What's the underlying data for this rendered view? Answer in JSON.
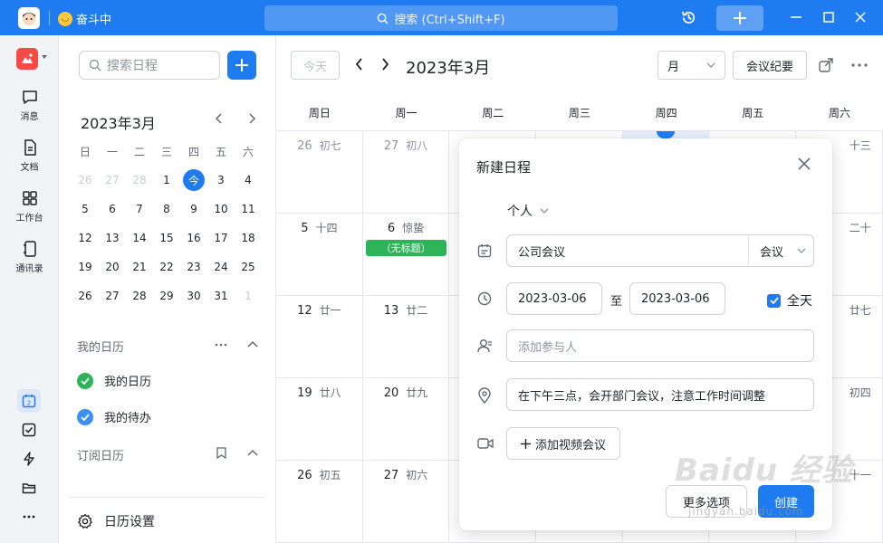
{
  "titlebar": {
    "status_text": "奋斗中",
    "search_placeholder": "搜索 (Ctrl+Shift+F)",
    "accent": "#1f7cf0"
  },
  "nav": {
    "items": [
      {
        "label": "消息",
        "icon": "chat-icon"
      },
      {
        "label": "文档",
        "icon": "doc-icon"
      },
      {
        "label": "工作台",
        "icon": "grid-icon"
      },
      {
        "label": "通讯录",
        "icon": "contacts-icon"
      }
    ],
    "bottom_calendar_badge": "2"
  },
  "side": {
    "search_placeholder": "搜索日程",
    "mini_title": "2023年3月",
    "weekday_heads": [
      "日",
      "一",
      "二",
      "三",
      "四",
      "五",
      "六"
    ],
    "days": [
      {
        "d": "26",
        "muted": true
      },
      {
        "d": "27",
        "muted": true
      },
      {
        "d": "28",
        "muted": true
      },
      {
        "d": "1"
      },
      {
        "d": "今",
        "today": true
      },
      {
        "d": "3"
      },
      {
        "d": "4"
      },
      {
        "d": "5"
      },
      {
        "d": "6"
      },
      {
        "d": "7"
      },
      {
        "d": "8"
      },
      {
        "d": "9"
      },
      {
        "d": "10"
      },
      {
        "d": "11"
      },
      {
        "d": "12"
      },
      {
        "d": "13"
      },
      {
        "d": "14"
      },
      {
        "d": "15"
      },
      {
        "d": "16"
      },
      {
        "d": "17"
      },
      {
        "d": "18"
      },
      {
        "d": "19"
      },
      {
        "d": "20"
      },
      {
        "d": "21"
      },
      {
        "d": "22"
      },
      {
        "d": "23"
      },
      {
        "d": "24"
      },
      {
        "d": "25"
      },
      {
        "d": "26"
      },
      {
        "d": "27"
      },
      {
        "d": "28"
      },
      {
        "d": "29"
      },
      {
        "d": "30"
      },
      {
        "d": "31"
      },
      {
        "d": "1",
        "muted": true
      }
    ],
    "my_calendars_title": "我的日历",
    "my_calendars": [
      {
        "label": "我的日历",
        "color": "#2db458"
      },
      {
        "label": "我的待办",
        "color": "#3b8ff5"
      }
    ],
    "subscribed_title": "订阅日历",
    "settings_label": "日历设置"
  },
  "main": {
    "today_button": "今天",
    "title": "2023年3月",
    "view_label": "月",
    "notes_button": "会议纪要",
    "weekdays": [
      "周日",
      "周一",
      "周二",
      "周三",
      "周四",
      "周五",
      "周六"
    ],
    "weeks": [
      [
        {
          "d": "26",
          "l": "初七",
          "muted": true
        },
        {
          "d": "27",
          "l": "初八",
          "muted": true
        },
        {
          "d": "",
          "l": ""
        },
        {
          "d": "",
          "l": ""
        },
        {
          "d": "",
          "l": "",
          "today": true
        },
        {
          "d": "",
          "l": ""
        },
        {
          "d": "",
          "l": "十三"
        }
      ],
      [
        {
          "d": "5",
          "l": "十四"
        },
        {
          "d": "6",
          "l": "惊蛰",
          "event": "（无标题）"
        },
        {
          "d": "",
          "l": ""
        },
        {
          "d": "",
          "l": ""
        },
        {
          "d": "",
          "l": ""
        },
        {
          "d": "",
          "l": ""
        },
        {
          "d": "",
          "l": "二十"
        }
      ],
      [
        {
          "d": "12",
          "l": "廿一"
        },
        {
          "d": "13",
          "l": "廿二"
        },
        {
          "d": "",
          "l": ""
        },
        {
          "d": "",
          "l": ""
        },
        {
          "d": "",
          "l": ""
        },
        {
          "d": "",
          "l": ""
        },
        {
          "d": "",
          "l": "廿七"
        }
      ],
      [
        {
          "d": "19",
          "l": "廿八"
        },
        {
          "d": "20",
          "l": "廿九"
        },
        {
          "d": "",
          "l": ""
        },
        {
          "d": "",
          "l": ""
        },
        {
          "d": "",
          "l": ""
        },
        {
          "d": "",
          "l": ""
        },
        {
          "d": "",
          "l": "初四"
        }
      ],
      [
        {
          "d": "26",
          "l": "初五"
        },
        {
          "d": "27",
          "l": "初六"
        },
        {
          "d": "",
          "l": ""
        },
        {
          "d": "",
          "l": ""
        },
        {
          "d": "",
          "l": ""
        },
        {
          "d": "",
          "l": ""
        },
        {
          "d": "",
          "l": "十一"
        }
      ]
    ]
  },
  "modal": {
    "title": "新建日程",
    "calendar_select": "个人",
    "event_title": "公司会议",
    "event_type": "会议",
    "start_date": "2023-03-06",
    "to_label": "至",
    "end_date": "2023-03-06",
    "all_day_label": "全天",
    "attendees_placeholder": "添加参与人",
    "location_value": "在下午三点，会开部门会议，注意工作时间调整",
    "video_button": "添加视频会议",
    "more_button": "更多选项",
    "create_button": "创建"
  },
  "watermark": {
    "text": "Baidu 经验",
    "sub": "jingyan.baidu.com"
  }
}
